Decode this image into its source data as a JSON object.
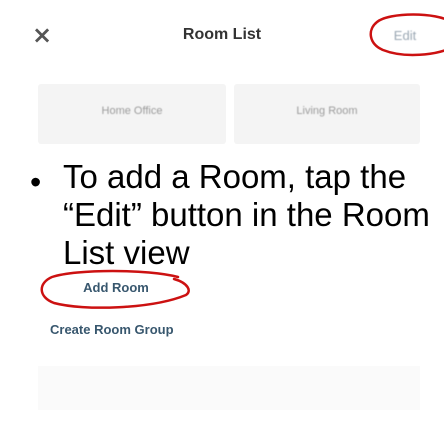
{
  "topbar": {
    "close_glyph": "×",
    "title": "Room List",
    "edit_label": "Edit",
    "highlight_color": "#cc1111"
  },
  "rooms": [
    {
      "label": "Home Office"
    },
    {
      "label": "Living Room"
    }
  ],
  "instruction": {
    "bullet": "•",
    "text": "To add a Room, tap the “Edit” button in the Room List view"
  },
  "actions": {
    "add_room_label": "Add Room",
    "create_group_label": "Create Room Group"
  }
}
